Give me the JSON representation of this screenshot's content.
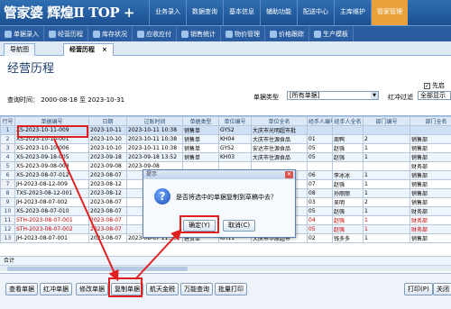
{
  "app": {
    "logo": "管家婆 辉煌Ⅱ TOP +",
    "topnav": [
      "业务录入",
      "数据查询",
      "基本信息",
      "辅助功能",
      "配送中心",
      "主库维护",
      "管家管理"
    ],
    "menubar": [
      "单据录入",
      "经营历程",
      "库存状况",
      "应收应付",
      "销售统计",
      "物价管理",
      "价格跟踪",
      "生产模板"
    ]
  },
  "tabs": [
    "导航图",
    "经营历程"
  ],
  "page": {
    "title": "经营历程",
    "query_time_label": "查询时间：",
    "date_from": "2000-08-18",
    "to_label": "至",
    "date_to": "2023-10-31",
    "type_label": "单据类型",
    "type_value": "[所有单据]",
    "red_label": "红冲过滤",
    "red_value": "全部显示",
    "check_label": "先启"
  },
  "grid": {
    "headers": [
      "行号",
      "单据编号",
      "日期",
      "过账时间",
      "单据类型",
      "单位编号",
      "单位全名",
      "经手人编号",
      "经手人全名",
      "部门编号",
      "部门全名"
    ],
    "rows": [
      [
        "1",
        "XS-2023-10-11-009",
        "2023-10-11",
        "2023-10-11 10:38",
        "销售单",
        "GYS2",
        "大庆市光明超市批",
        "",
        "",
        "",
        ""
      ],
      [
        "2",
        "XS-2023-10-10-001",
        "2023-10-10",
        "2023-10-11 10:38",
        "销售单",
        "KH04",
        "大庆市住源食品",
        "01",
        "周鸭",
        "2",
        "销售部"
      ],
      [
        "3",
        "XS-2023-10-10-006",
        "2023-10-10",
        "2023-10-11 10:38",
        "销售单",
        "GYS2",
        "安达市住源食品",
        "05",
        "赵强",
        "1",
        "销售部"
      ],
      [
        "4",
        "XS-2023-09-18-005",
        "2023-09-18",
        "2023-09-18 13:52",
        "销售单",
        "KH03",
        "大庆市住源食品",
        "05",
        "赵强",
        "1",
        "销售部"
      ],
      [
        "5",
        "XS-2023-09-08-003",
        "2023-09-08",
        "2023-09-08",
        "",
        "",
        "",
        "",
        "",
        "",
        "财务部"
      ],
      [
        "6",
        "XS-2023-08-07-012",
        "2023-08-07",
        "",
        "",
        "",
        "全部",
        "06",
        "李冰冰",
        "1",
        "销售部"
      ],
      [
        "7",
        "JH-2023-08-12-009",
        "2023-08-12",
        "",
        "",
        "",
        "",
        "07",
        "赵强",
        "1",
        "销售部"
      ],
      [
        "8",
        "TXS-2023-08-12-001",
        "2023-08-12",
        "",
        "",
        "",
        "",
        "08",
        "孙丽丽",
        "1",
        "销售部"
      ],
      [
        "9",
        "JH-2023-08-07-002",
        "2023-08-07",
        "",
        "",
        "",
        "",
        "03",
        "吴明",
        "2",
        "销售部"
      ],
      [
        "10",
        "XS-2023-08-07-010",
        "2023-08-07",
        "",
        "",
        "",
        "",
        "05",
        "赵强",
        "1",
        "财务部"
      ],
      [
        "11",
        "STH-2023-08-07-001",
        "2023-08-07",
        "",
        "",
        "",
        "",
        "04",
        "赵强",
        "1",
        "财务部"
      ],
      [
        "12",
        "STH-2023-08-07-002",
        "2023-08-07",
        "",
        "",
        "",
        "",
        "05",
        "赵强",
        "1",
        "财务部"
      ],
      [
        "13",
        "JH-2023-08-07-001",
        "2023-08-07",
        "2023-08-07 11:30",
        "进货单",
        "KH11",
        "大庆市华原超市",
        "02",
        "钱多多",
        "1",
        "销售部"
      ]
    ],
    "red_rows": [
      10,
      11
    ],
    "sum_label": "合计"
  },
  "dialog": {
    "title": "提示",
    "message": "是否将选中的单据复制到草稿中去？",
    "ok": "确定(Y)",
    "cancel": "取消(C)"
  },
  "bottom": {
    "buttons": [
      "查看单据",
      "红冲单据",
      "修改单据",
      "复制单据",
      "航天金税",
      "万能查询",
      "批量打印"
    ],
    "print": "打印(P)",
    "close": "关闭"
  }
}
